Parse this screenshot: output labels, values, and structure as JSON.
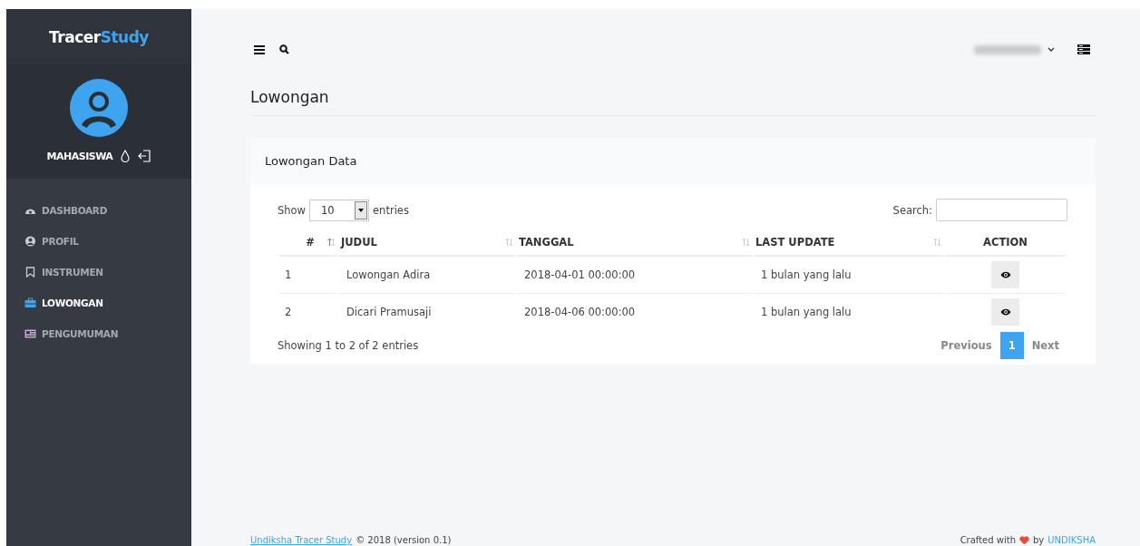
{
  "sidebar": {
    "brand": {
      "part_1": "Tracer",
      "part_2": "Study"
    },
    "user": {
      "role": "MAHASISWA"
    },
    "items": [
      {
        "label": "DASHBOARD",
        "selected": false
      },
      {
        "label": "PROFIL",
        "selected": false
      },
      {
        "label": "INSTRUMEN",
        "selected": false
      },
      {
        "label": "LOWONGAN",
        "selected": true
      },
      {
        "label": "PENGUMUMAN",
        "selected": false
      }
    ]
  },
  "page_title": "Lowongan",
  "panel": {
    "title": "Lowongan Data",
    "length": {
      "before": "Show",
      "value": "10",
      "after": "entries"
    },
    "search": {
      "label": "Search:"
    },
    "table": {
      "columns": [
        "#",
        "JUDUL",
        "TANGGAL",
        "LAST UPDATE",
        "ACTION"
      ],
      "rows": [
        [
          "1",
          "Lowongan Adira",
          "2018-04-01 00:00:00",
          "1 bulan yang lalu"
        ],
        [
          "2",
          "Dicari Pramusaji",
          "2018-04-06 00:00:00",
          "1 bulan yang lalu"
        ]
      ]
    },
    "info": "Showing 1 to 2 of 2 entries",
    "pagination": {
      "previous": "Previous",
      "pages": [
        {
          "label": "1",
          "selected": true
        }
      ],
      "next": "Next"
    }
  },
  "footer": {
    "left_link": "Undiksha Tracer Study",
    "left_text": "© 2018 (version 0.1)",
    "right_text_1": "Crafted with",
    "right_text_2": "by",
    "right_link": "UNDIKSHA"
  }
}
